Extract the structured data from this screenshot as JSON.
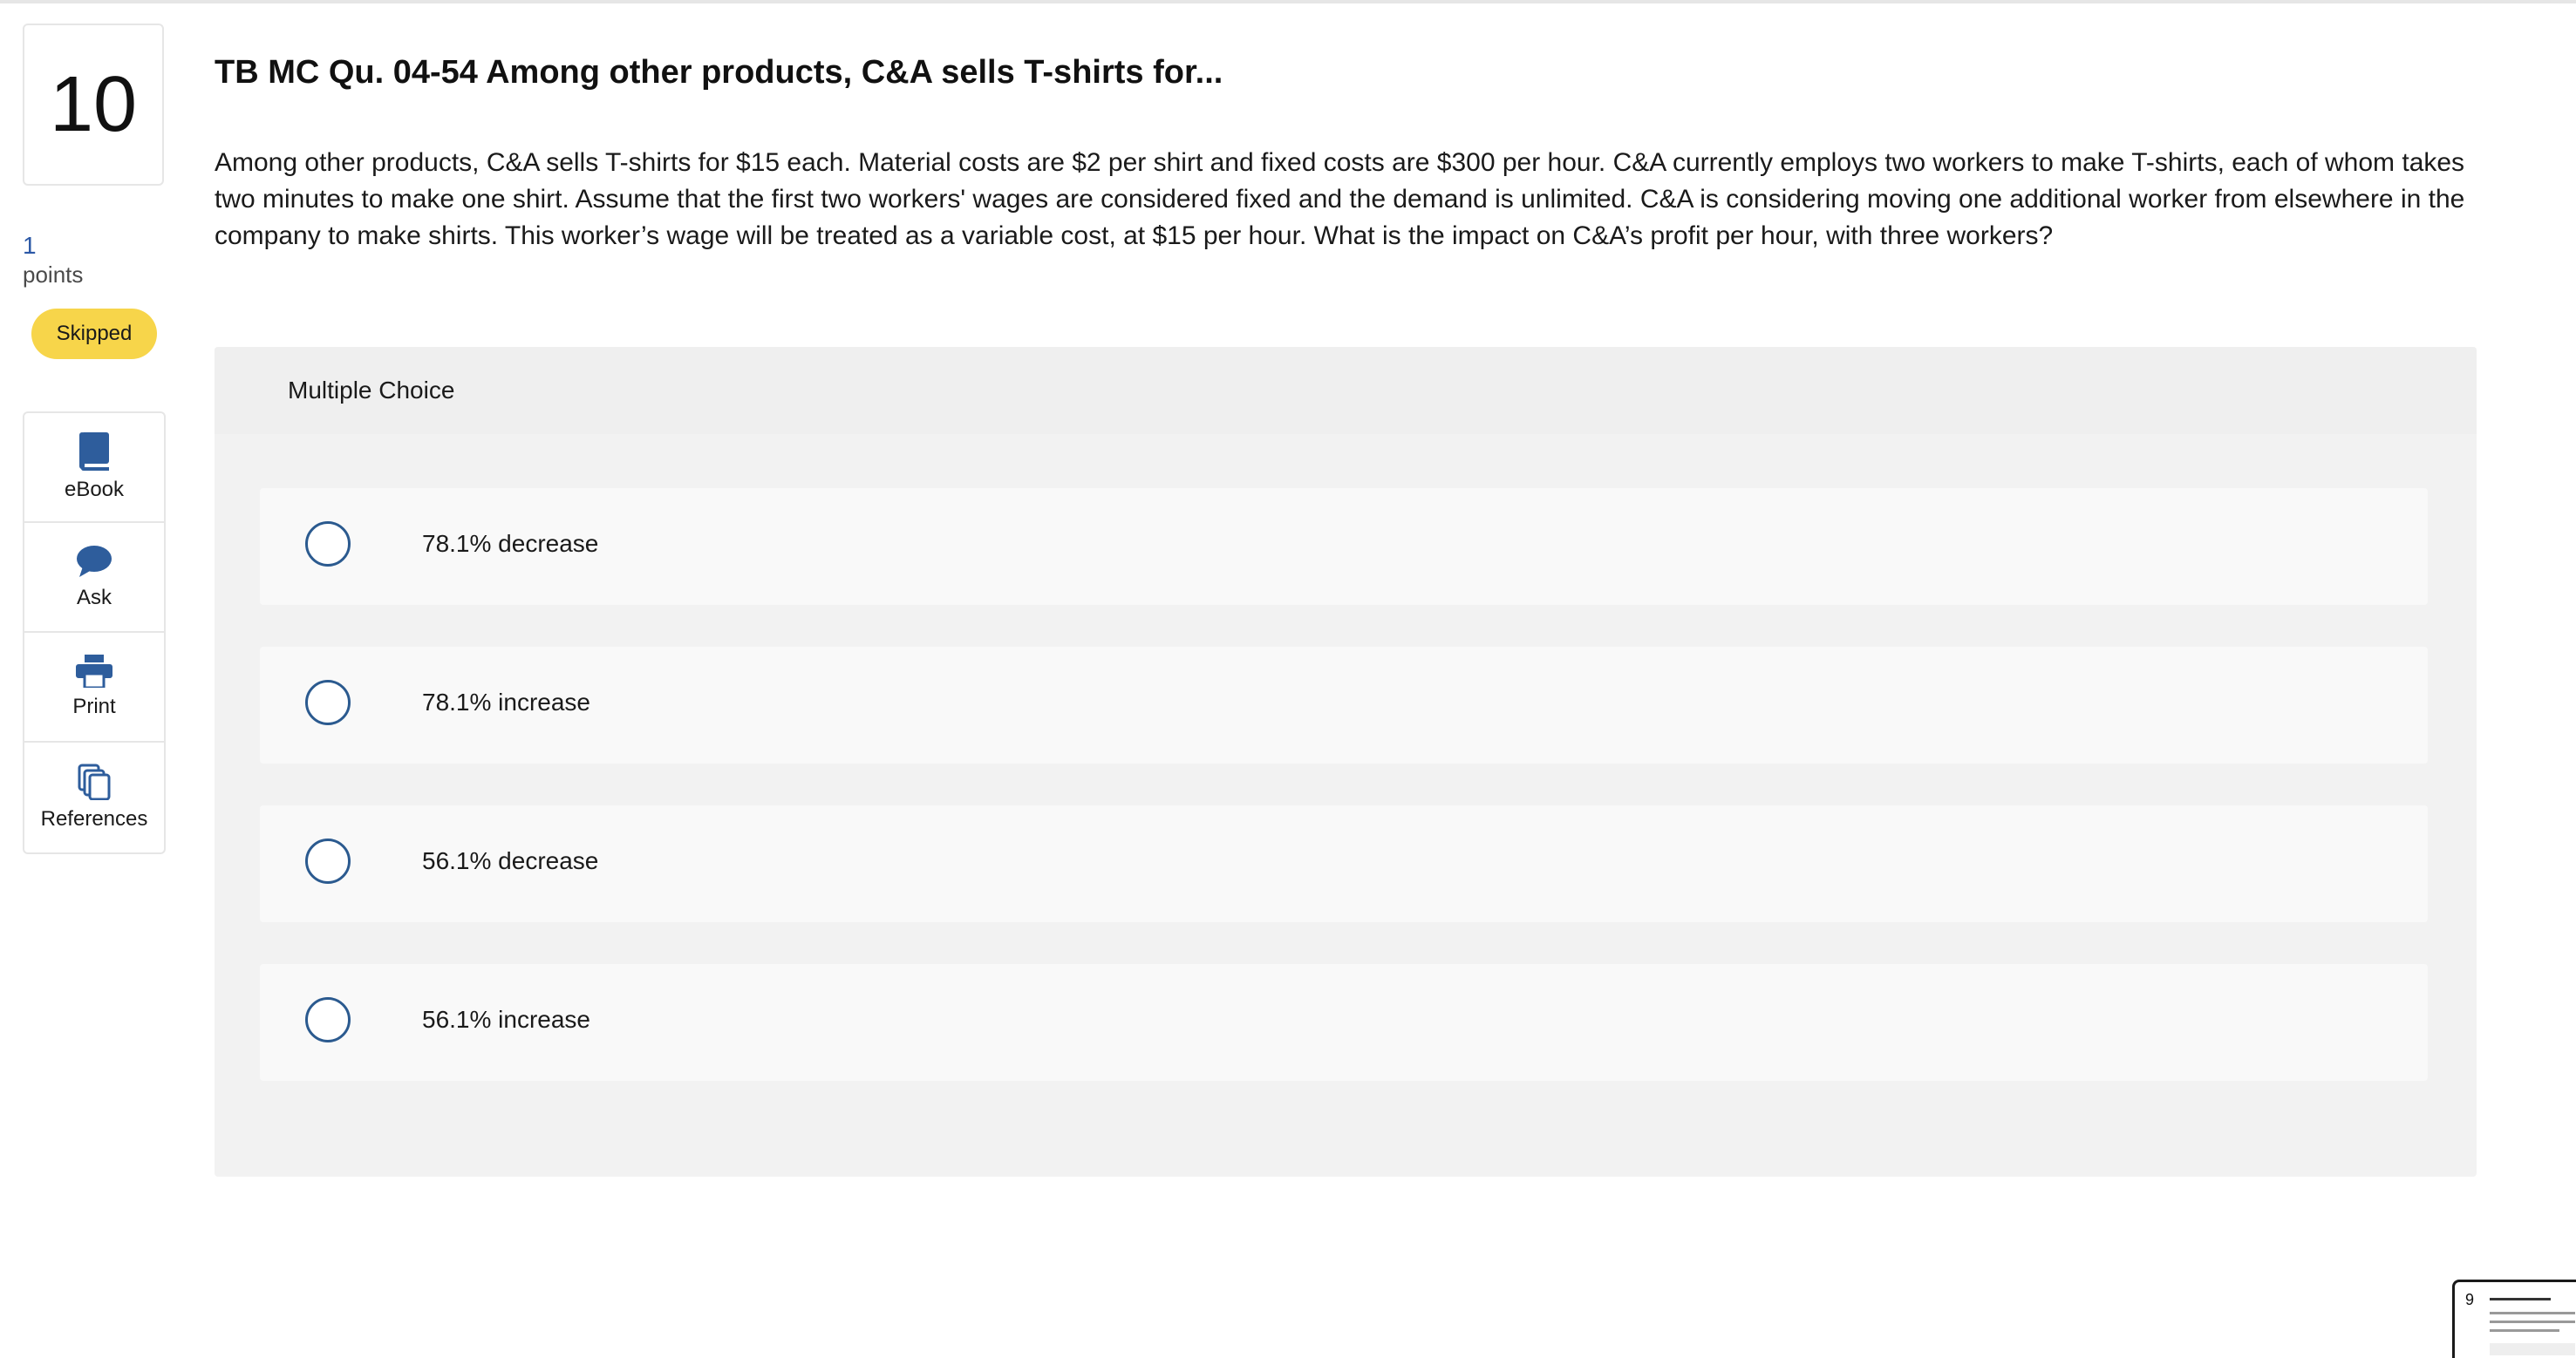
{
  "question": {
    "number": "10",
    "points_value": "1",
    "points_label": "points",
    "status": "Skipped",
    "title": "TB MC Qu. 04-54 Among other products, C&A sells T-shirts for...",
    "text": "Among other products, C&A sells T-shirts for $15 each. Material costs are $2 per shirt and fixed costs are $300 per hour. C&A currently employs two workers to make T-shirts, each of whom takes two minutes to make one shirt. Assume that the first two workers' wages are considered fixed and the demand is unlimited. C&A is considering moving one additional worker from elsewhere in the company to make shirts. This worker’s wage will be treated as a variable cost, at $15 per hour. What is the impact on C&A’s profit per hour, with three workers?"
  },
  "tools": [
    {
      "label": "eBook",
      "icon": "book-icon"
    },
    {
      "label": "Ask",
      "icon": "chat-bubble-icon"
    },
    {
      "label": "Print",
      "icon": "printer-icon"
    },
    {
      "label": "References",
      "icon": "documents-icon"
    }
  ],
  "multiple_choice": {
    "header": "Multiple Choice",
    "options": [
      {
        "label": "78.1% decrease",
        "selected": false
      },
      {
        "label": "78.1% increase",
        "selected": false
      },
      {
        "label": "56.1% decrease",
        "selected": false
      },
      {
        "label": "56.1% increase",
        "selected": false
      }
    ]
  },
  "thumbnail": {
    "number": "9"
  },
  "colors": {
    "accent": "#2b5a8f",
    "badge": "#f7d54a",
    "points": "#2b58a6",
    "panel": "#f2f2f2"
  }
}
